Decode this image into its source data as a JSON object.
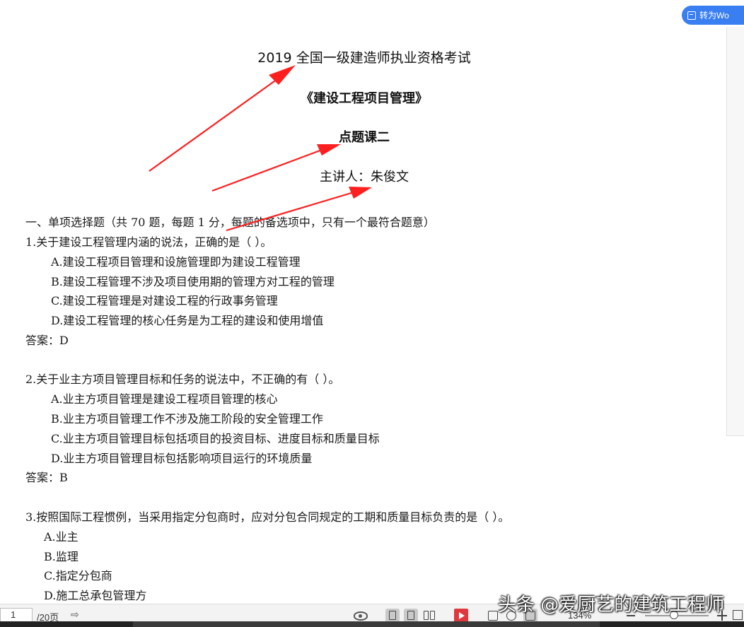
{
  "convert_button": {
    "label": "转为Wo"
  },
  "titles": {
    "line1": "2019 全国一级建造师执业资格考试",
    "line2": "《建设工程项目管理》",
    "line3": "点题课二",
    "line4": "主讲人：朱俊文"
  },
  "section_heading": "一、单项选择题（共 70 题，每题 1 分，每题的备选项中，只有一个最符合题意）",
  "questions": [
    {
      "stem": "1.关于建设工程管理内涵的说法，正确的是（  ）。",
      "options": [
        "A.建设工程项目管理和设施管理即为建设工程管理",
        "B.建设工程管理不涉及项目使用期的管理方对工程的管理",
        "C.建设工程管理是对建设工程的行政事务管理",
        "D.建设工程管理的核心任务是为工程的建设和使用增值"
      ],
      "answer": "答案：D"
    },
    {
      "stem": "2.关于业主方项目管理目标和任务的说法中，不正确的有（  ）。",
      "options": [
        "A.业主方项目管理是建设工程项目管理的核心",
        "B.业主方项目管理工作不涉及施工阶段的安全管理工作",
        "C.业主方项目管理目标包括项目的投资目标、进度目标和质量目标",
        "D.业主方项目管理目标包括影响项目运行的环境质量"
      ],
      "answer": "答案：B"
    },
    {
      "stem": "3.按照国际工程惯例，当采用指定分包商时，应对分包合同规定的工期和质量目标负责的是（    ）。",
      "options": [
        "A.业主",
        "B.监理",
        "C.指定分包商",
        "D.施工总承包管理方"
      ]
    }
  ],
  "watermark": "头条 @爱厨艺的建筑工程师",
  "statusbar": {
    "current_page": "1",
    "total_pages": "/20页",
    "zoom": "134%",
    "zoom_slider_fraction": 0.45
  },
  "colors": {
    "accent": "#3a7ff2",
    "arrow": "#ff1f1f",
    "play": "#e0383e"
  },
  "icons": [
    "document-icon",
    "next-page-icon",
    "eye-icon",
    "view-icon",
    "play-icon",
    "fit-icon",
    "zoom-out-icon",
    "zoom-in-icon",
    "fullscreen-icon"
  ]
}
